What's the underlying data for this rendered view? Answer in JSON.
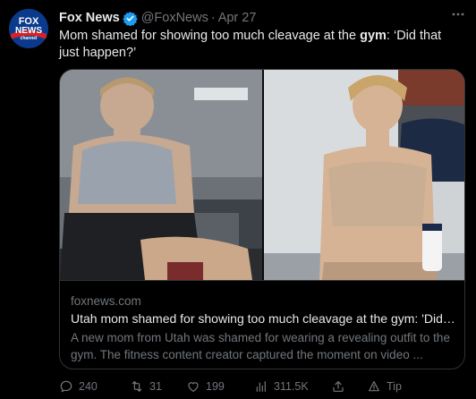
{
  "author": {
    "display_name": "Fox News",
    "handle": "@FoxNews",
    "separator": "·",
    "time": "Apr 27",
    "avatar_text": {
      "line1": "FOX",
      "line2": "NEWS",
      "line3": "channel"
    }
  },
  "tweet": {
    "text_before": "Mom shamed for showing too much cleavage at the ",
    "text_bold": "gym",
    "text_after": ": ‘Did that just happen?’"
  },
  "card": {
    "domain": "foxnews.com",
    "title": "Utah mom shamed for showing too much cleavage at the gym: 'Did t...",
    "description": "A new mom from Utah was shamed for wearing a revealing outfit to the gym. The fitness content creator captured the moment on video ..."
  },
  "actions": {
    "replies": "240",
    "retweets": "31",
    "likes": "199",
    "views": "311.5K",
    "tip": "Tip"
  },
  "icons": {
    "verified": "verified-badge-icon",
    "more": "more-icon",
    "reply": "reply-icon",
    "retweet": "retweet-icon",
    "like": "heart-icon",
    "views": "views-icon",
    "share": "share-icon",
    "tip": "tip-icon"
  },
  "colors": {
    "background": "#000000",
    "text": "#e7e9ea",
    "muted": "#71767b",
    "border": "#2f3336",
    "verified": "#1d9bf0",
    "fox_blue": "#0b3a8c",
    "fox_red": "#d2232a"
  }
}
